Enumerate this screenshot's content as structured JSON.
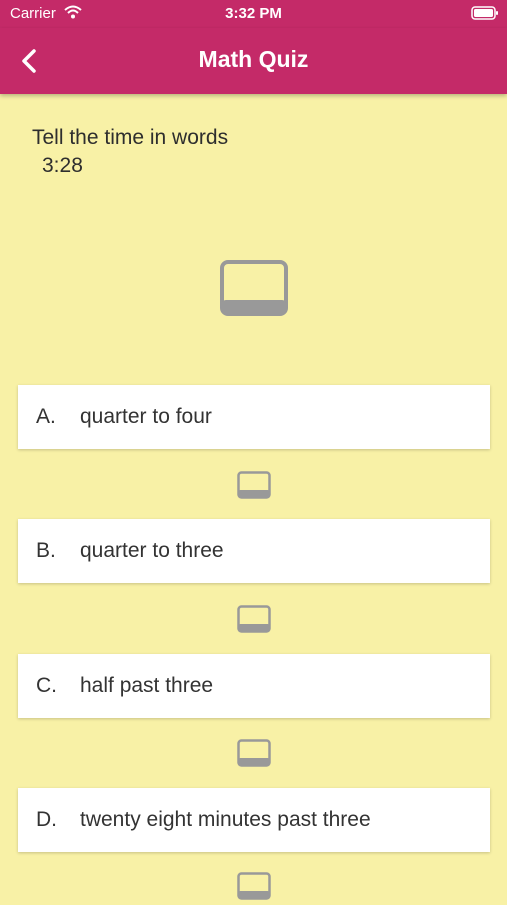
{
  "status_bar": {
    "carrier": "Carrier",
    "time": "3:32 PM"
  },
  "nav": {
    "title": "Math Quiz",
    "back_icon": "chevron-left-icon"
  },
  "question": {
    "prompt": "Tell the time in words",
    "value": "3:28"
  },
  "options": [
    {
      "letter": "A.",
      "text": "quarter to four"
    },
    {
      "letter": "B.",
      "text": "quarter to three"
    },
    {
      "letter": "C.",
      "text": "half past three"
    },
    {
      "letter": "D.",
      "text": "twenty eight minutes past three"
    }
  ],
  "colors": {
    "header": "#c42a68",
    "background": "#f8f1a6",
    "card": "#ffffff",
    "icon": "#999999"
  }
}
